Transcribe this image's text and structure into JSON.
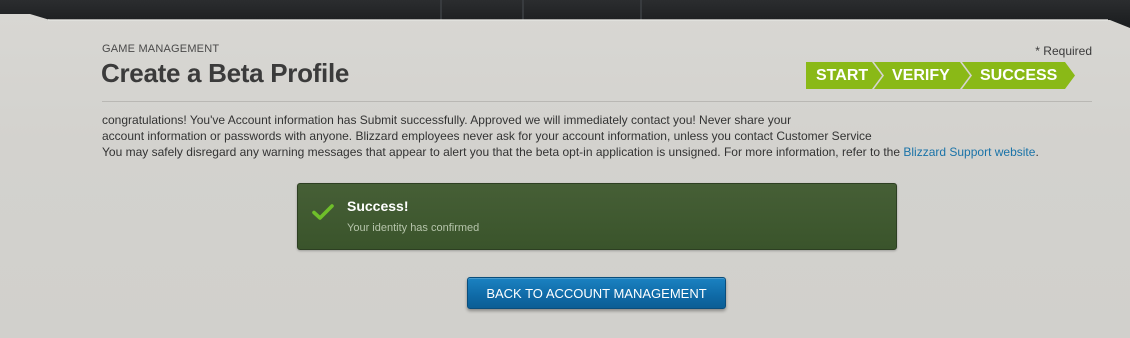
{
  "header": {
    "section_label": "GAME MANAGEMENT",
    "title": "Create a Beta Profile",
    "required_note": "* Required"
  },
  "steps": [
    {
      "label": "START"
    },
    {
      "label": "VERIFY"
    },
    {
      "label": "SUCCESS"
    }
  ],
  "info": {
    "line1": "congratulations! You've Account information has Submit successfully. Approved we will immediately contact you! Never share your",
    "line2": "account information or passwords with anyone. Blizzard employees never ask for your account information, unless you contact Customer Service",
    "line3_prefix": "You may safely disregard any warning messages that appear to alert you that the beta opt-in application is unsigned. For more information, refer to the",
    "line3_link": "Blizzard Support website",
    "line3_suffix": "."
  },
  "alert": {
    "icon": "check-icon",
    "title": "Success!",
    "message": "Your identity has confirmed"
  },
  "actions": {
    "back_label": "BACK TO ACCOUNT MANAGEMENT"
  },
  "colors": {
    "step_green": "#8ab917",
    "alert_green": "#3f5930",
    "button_blue": "#0f6aa6",
    "link_blue": "#1a73a8"
  }
}
